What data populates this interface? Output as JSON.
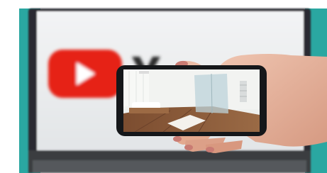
{
  "photo": {
    "kind": "photograph",
    "background_brand_text": "YouTube",
    "colors": {
      "page_bg": "#ffffff",
      "teal_backdrop": "#2aa7a1",
      "laptop_bezel": "#2a2c30",
      "screen_bg": "#eceff1",
      "youtube_red": "#e62117",
      "wordmark": "#2b2b2b",
      "skin": "#e7b39e",
      "nail": "#c97b73",
      "phone_body": "#15171a",
      "room_wall": "#eef0ee",
      "wood_floor": "#8a5a3a",
      "glass": "#bcd3da"
    }
  }
}
